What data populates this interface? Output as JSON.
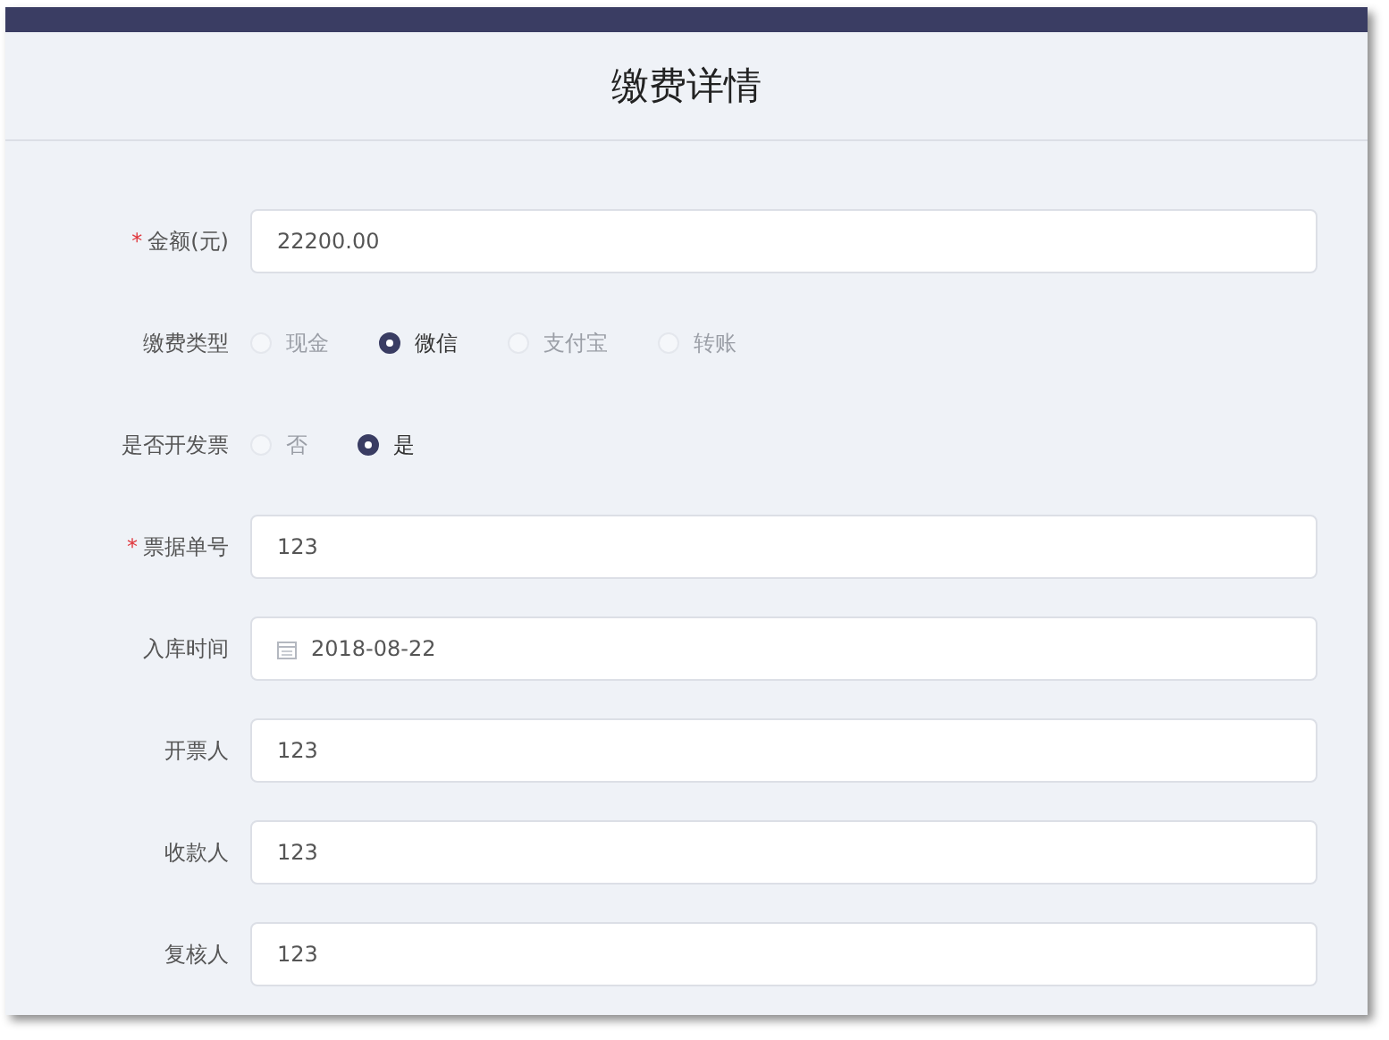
{
  "title": "缴费详情",
  "fields": [
    {
      "kind": "input",
      "label": "金额(元)",
      "required_mark": "*",
      "value": "22200.00"
    },
    {
      "kind": "radio",
      "label": "缴费类型",
      "options": [
        {
          "label": "现金",
          "selected": false
        },
        {
          "label": "微信",
          "selected": true
        },
        {
          "label": "支付宝",
          "selected": false
        },
        {
          "label": "转账",
          "selected": false
        }
      ]
    },
    {
      "kind": "radio",
      "label": "是否开发票",
      "options": [
        {
          "label": "否",
          "selected": false
        },
        {
          "label": "是",
          "selected": true
        }
      ]
    },
    {
      "kind": "input",
      "label": "票据单号",
      "required_mark": "*",
      "value": "123"
    },
    {
      "kind": "date",
      "label": "入库时间",
      "value": "2018-08-22"
    },
    {
      "kind": "input",
      "label": "开票人",
      "value": "123"
    },
    {
      "kind": "input",
      "label": "收款人",
      "value": "123"
    },
    {
      "kind": "input",
      "label": "复核人",
      "value": "123"
    }
  ]
}
